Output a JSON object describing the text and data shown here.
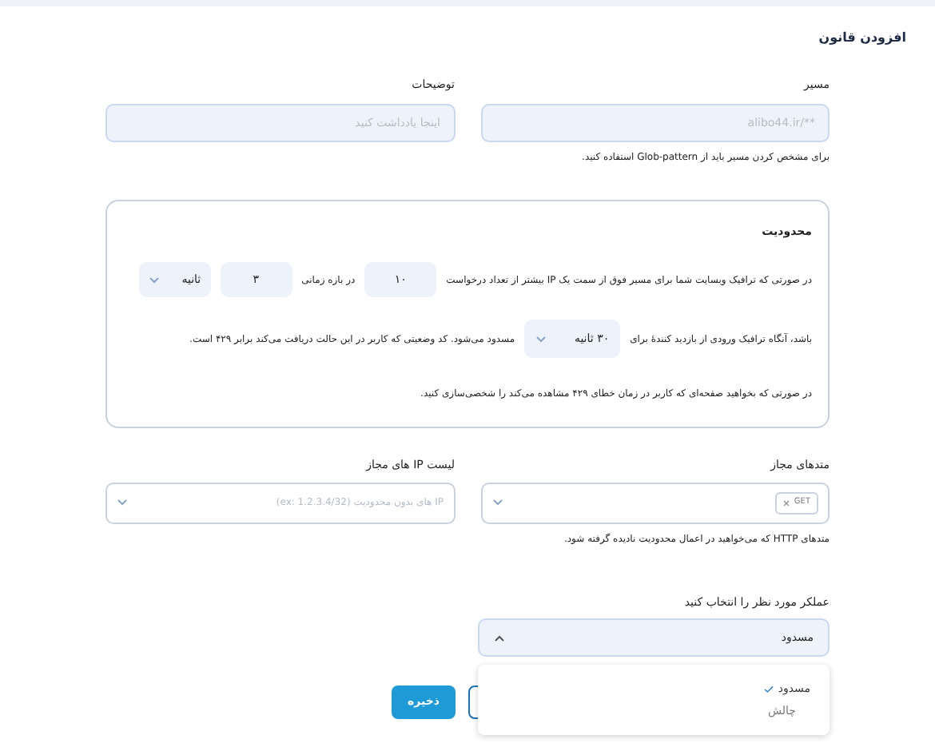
{
  "title": "افزودن قانون",
  "path": {
    "label": "مسیر",
    "placeholder": "alibo44.ir/**",
    "hint": "برای مشخص کردن مسیر باید از Glob-pattern استفاده کنید."
  },
  "description": {
    "label": "توضیحات",
    "placeholder": "اینجا یادداشت کنید"
  },
  "limit": {
    "title": "محدودیت",
    "line_1": {
      "text": "در صورتی که ترافیک وبسایت شما برای مسیر فوق از سمت یک IP بیشتر از تعداد درخواست",
      "requests": "۱۰",
      "period_label": "در بازه زمانی",
      "period": "۳",
      "unit": "ثانیه"
    },
    "line_2": {
      "text_before": "باشد، آنگاه ترافیک ورودی از بازدید کنندهٔ برای",
      "block_duration": "۳۰ ثانیه",
      "text_after": "مسدود می‌شود. کد وضعیتی که کاربر در این حالت دریافت می‌کند برابر ۴۲۹ است."
    },
    "line_3": "در صورتی که بخواهید صفحه‌ای که کاربر در زمان خطای ۴۲۹ مشاهده می‌کند را شخصی‌سازی کنید."
  },
  "methods": {
    "label": "متدهای مجاز",
    "tags": [
      "GET"
    ],
    "hint": "متدهای HTTP که می‌خواهید در اعمال محدودیت نادیده گرفته شود."
  },
  "ip_list": {
    "label": "لیست IP های مجاز",
    "placeholder": "IP های بدون محدودیت (ex: 1.2.3.4/32)"
  },
  "action": {
    "label": "عملکر مورد نظر را انتخاب کنید",
    "value": "مسدود",
    "expanded": true,
    "options": [
      {
        "label": "مسدود",
        "selected": true
      },
      {
        "label": "چالش",
        "selected": false
      }
    ]
  },
  "save_button": "ذخیره"
}
